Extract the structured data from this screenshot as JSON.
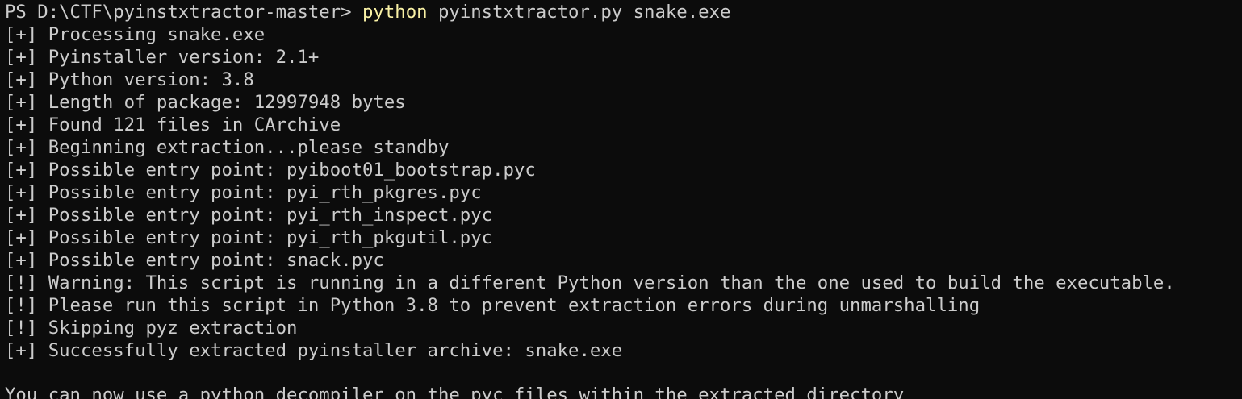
{
  "terminal": {
    "prompt": "PS D:\\CTF\\pyinstxtractor-master> ",
    "command": {
      "executable": "python",
      "args": " pyinstxtractor.py snake.exe"
    },
    "output": [
      "[+] Processing snake.exe",
      "[+] Pyinstaller version: 2.1+",
      "[+] Python version: 3.8",
      "[+] Length of package: 12997948 bytes",
      "[+] Found 121 files in CArchive",
      "[+] Beginning extraction...please standby",
      "[+] Possible entry point: pyiboot01_bootstrap.pyc",
      "[+] Possible entry point: pyi_rth_pkgres.pyc",
      "[+] Possible entry point: pyi_rth_inspect.pyc",
      "[+] Possible entry point: pyi_rth_pkgutil.pyc",
      "[+] Possible entry point: snack.pyc",
      "[!] Warning: This script is running in a different Python version than the one used to build the executable.",
      "[!] Please run this script in Python 3.8 to prevent extraction errors during unmarshalling",
      "[!] Skipping pyz extraction",
      "[+] Successfully extracted pyinstaller archive: snake.exe",
      "",
      "You can now use a python decompiler on the pyc files within the extracted directory"
    ]
  },
  "colors": {
    "background": "#0c0c0c",
    "text": "#cccccc",
    "command_highlight": "#f9f1a5"
  }
}
